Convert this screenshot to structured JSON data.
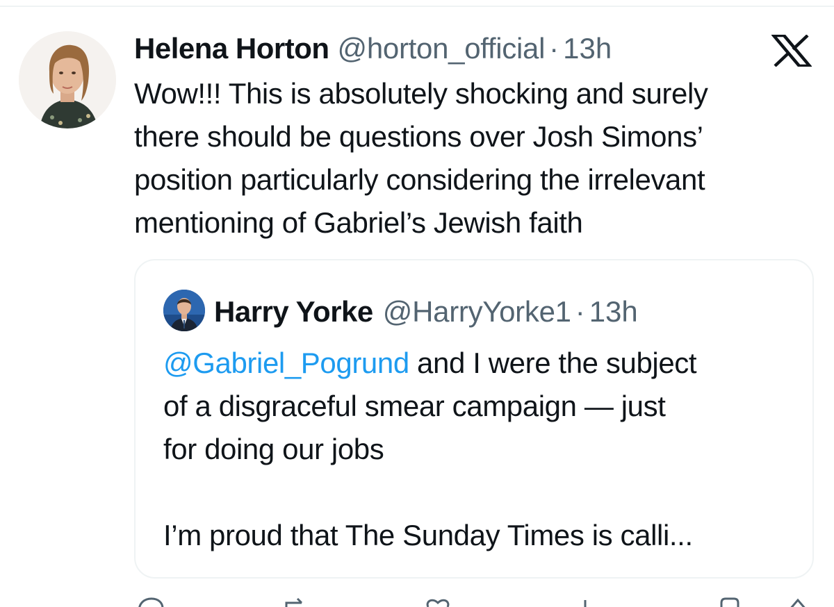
{
  "post": {
    "author_name": "Helena Horton",
    "author_handle": "@horton_official",
    "separator": "·",
    "timestamp": "13h",
    "text_lines": [
      "Wow!!! This is absolutely shocking and surely",
      "there should be questions over Josh Simons’",
      "position particularly considering the irrelevant",
      "mentioning of Gabriel’s Jewish faith"
    ]
  },
  "quote": {
    "author_name": "Harry Yorke",
    "author_handle": "@HarryYorke1",
    "separator": "·",
    "timestamp": "13h",
    "mention": "@Gabriel_Pogrund",
    "line1_rest": " and I were the subject",
    "line2": "of a disgraceful smear campaign — just",
    "line3": "for doing our jobs",
    "line4": "I’m proud that The Sunday Times is calli..."
  },
  "icons": {
    "brand": "x-logo-icon",
    "actions": [
      "reply-icon",
      "repost-icon",
      "like-icon",
      "views-icon",
      "bookmark-icon",
      "share-icon"
    ]
  },
  "colors": {
    "text": "#0f1419",
    "secondary": "#536471",
    "link": "#1d9bf0",
    "border": "#eff3f4"
  }
}
